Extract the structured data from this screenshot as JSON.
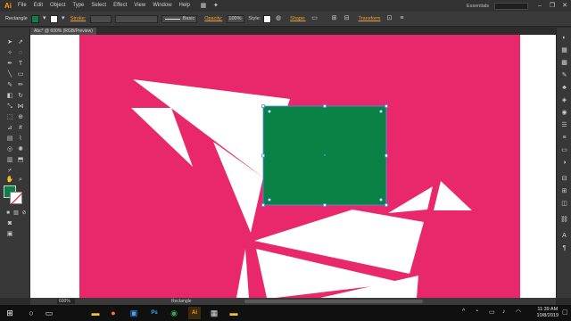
{
  "app": {
    "logo": "Ai",
    "menu": [
      "File",
      "Edit",
      "Object",
      "Type",
      "Select",
      "Effect",
      "View",
      "Window",
      "Help"
    ],
    "workspace": "Essentials",
    "window_controls": [
      "–",
      "❐",
      "✕"
    ]
  },
  "control_bar": {
    "selection": "Rectangle",
    "stroke_label": "Stroke:",
    "brush_label": "Basic",
    "opacity_label": "Opacity:",
    "opacity_value": "100%",
    "style_label": "Style:",
    "shape_label": "Shape:",
    "transform_label": "Transform"
  },
  "document": {
    "tab_title": "Abc* @ 600% (RGB/Preview)"
  },
  "status_bar": {
    "zoom": "600%",
    "current_tool": "Rectangle"
  },
  "colors": {
    "fill": "#0a8245",
    "background": "#e8286a",
    "shape_white": "#ffffff",
    "selected_rect": "#0a8245"
  },
  "icons": {
    "tools": [
      "selection-icon",
      "direct-selection-icon",
      "magic-wand-icon",
      "lasso-icon",
      "pen-icon",
      "type-icon",
      "line-icon",
      "rectangle-icon",
      "paintbrush-icon",
      "pencil-icon",
      "eraser-icon",
      "rotate-icon",
      "scale-icon",
      "width-icon",
      "free-transform-icon",
      "shape-builder-icon",
      "perspective-icon",
      "mesh-icon",
      "gradient-icon",
      "eyedropper-icon",
      "blend-icon",
      "symbol-sprayer-icon",
      "graph-icon",
      "artboard-icon",
      "slice-icon",
      "hand-icon",
      "zoom-icon"
    ],
    "dock": [
      "color-icon",
      "color-guide-icon",
      "swatches-icon",
      "brushes-icon",
      "symbols-icon",
      "graphic-styles-icon",
      "appearance-icon",
      "layers-icon",
      "stroke-icon",
      "gradient-panel-icon",
      "transparency-icon",
      "align-icon",
      "transform-panel-icon",
      "pathfinder-icon",
      "links-icon",
      "character-icon",
      "paragraph-icon"
    ]
  },
  "taskbar": {
    "time": "11:39 AM",
    "date": "10/8/2019"
  }
}
